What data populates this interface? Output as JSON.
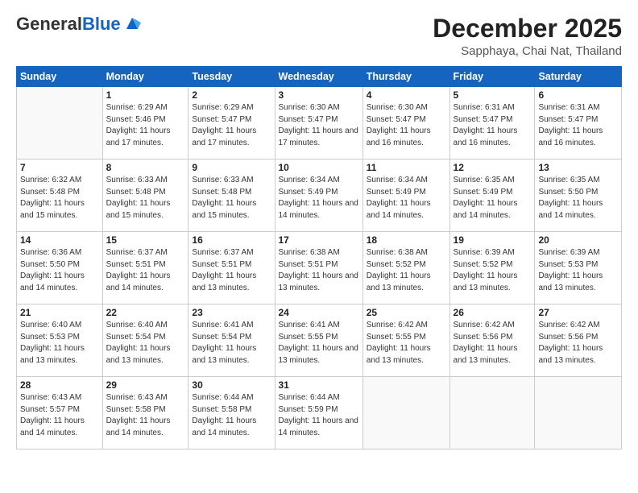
{
  "header": {
    "logo_general": "General",
    "logo_blue": "Blue",
    "month_title": "December 2025",
    "location": "Sapphaya, Chai Nat, Thailand"
  },
  "weekdays": [
    "Sunday",
    "Monday",
    "Tuesday",
    "Wednesday",
    "Thursday",
    "Friday",
    "Saturday"
  ],
  "weeks": [
    [
      {
        "day": "",
        "sunrise": "",
        "sunset": "",
        "daylight": ""
      },
      {
        "day": "1",
        "sunrise": "Sunrise: 6:29 AM",
        "sunset": "Sunset: 5:46 PM",
        "daylight": "Daylight: 11 hours and 17 minutes."
      },
      {
        "day": "2",
        "sunrise": "Sunrise: 6:29 AM",
        "sunset": "Sunset: 5:47 PM",
        "daylight": "Daylight: 11 hours and 17 minutes."
      },
      {
        "day": "3",
        "sunrise": "Sunrise: 6:30 AM",
        "sunset": "Sunset: 5:47 PM",
        "daylight": "Daylight: 11 hours and 17 minutes."
      },
      {
        "day": "4",
        "sunrise": "Sunrise: 6:30 AM",
        "sunset": "Sunset: 5:47 PM",
        "daylight": "Daylight: 11 hours and 16 minutes."
      },
      {
        "day": "5",
        "sunrise": "Sunrise: 6:31 AM",
        "sunset": "Sunset: 5:47 PM",
        "daylight": "Daylight: 11 hours and 16 minutes."
      },
      {
        "day": "6",
        "sunrise": "Sunrise: 6:31 AM",
        "sunset": "Sunset: 5:47 PM",
        "daylight": "Daylight: 11 hours and 16 minutes."
      }
    ],
    [
      {
        "day": "7",
        "sunrise": "Sunrise: 6:32 AM",
        "sunset": "Sunset: 5:48 PM",
        "daylight": "Daylight: 11 hours and 15 minutes."
      },
      {
        "day": "8",
        "sunrise": "Sunrise: 6:33 AM",
        "sunset": "Sunset: 5:48 PM",
        "daylight": "Daylight: 11 hours and 15 minutes."
      },
      {
        "day": "9",
        "sunrise": "Sunrise: 6:33 AM",
        "sunset": "Sunset: 5:48 PM",
        "daylight": "Daylight: 11 hours and 15 minutes."
      },
      {
        "day": "10",
        "sunrise": "Sunrise: 6:34 AM",
        "sunset": "Sunset: 5:49 PM",
        "daylight": "Daylight: 11 hours and 14 minutes."
      },
      {
        "day": "11",
        "sunrise": "Sunrise: 6:34 AM",
        "sunset": "Sunset: 5:49 PM",
        "daylight": "Daylight: 11 hours and 14 minutes."
      },
      {
        "day": "12",
        "sunrise": "Sunrise: 6:35 AM",
        "sunset": "Sunset: 5:49 PM",
        "daylight": "Daylight: 11 hours and 14 minutes."
      },
      {
        "day": "13",
        "sunrise": "Sunrise: 6:35 AM",
        "sunset": "Sunset: 5:50 PM",
        "daylight": "Daylight: 11 hours and 14 minutes."
      }
    ],
    [
      {
        "day": "14",
        "sunrise": "Sunrise: 6:36 AM",
        "sunset": "Sunset: 5:50 PM",
        "daylight": "Daylight: 11 hours and 14 minutes."
      },
      {
        "day": "15",
        "sunrise": "Sunrise: 6:37 AM",
        "sunset": "Sunset: 5:51 PM",
        "daylight": "Daylight: 11 hours and 14 minutes."
      },
      {
        "day": "16",
        "sunrise": "Sunrise: 6:37 AM",
        "sunset": "Sunset: 5:51 PM",
        "daylight": "Daylight: 11 hours and 13 minutes."
      },
      {
        "day": "17",
        "sunrise": "Sunrise: 6:38 AM",
        "sunset": "Sunset: 5:51 PM",
        "daylight": "Daylight: 11 hours and 13 minutes."
      },
      {
        "day": "18",
        "sunrise": "Sunrise: 6:38 AM",
        "sunset": "Sunset: 5:52 PM",
        "daylight": "Daylight: 11 hours and 13 minutes."
      },
      {
        "day": "19",
        "sunrise": "Sunrise: 6:39 AM",
        "sunset": "Sunset: 5:52 PM",
        "daylight": "Daylight: 11 hours and 13 minutes."
      },
      {
        "day": "20",
        "sunrise": "Sunrise: 6:39 AM",
        "sunset": "Sunset: 5:53 PM",
        "daylight": "Daylight: 11 hours and 13 minutes."
      }
    ],
    [
      {
        "day": "21",
        "sunrise": "Sunrise: 6:40 AM",
        "sunset": "Sunset: 5:53 PM",
        "daylight": "Daylight: 11 hours and 13 minutes."
      },
      {
        "day": "22",
        "sunrise": "Sunrise: 6:40 AM",
        "sunset": "Sunset: 5:54 PM",
        "daylight": "Daylight: 11 hours and 13 minutes."
      },
      {
        "day": "23",
        "sunrise": "Sunrise: 6:41 AM",
        "sunset": "Sunset: 5:54 PM",
        "daylight": "Daylight: 11 hours and 13 minutes."
      },
      {
        "day": "24",
        "sunrise": "Sunrise: 6:41 AM",
        "sunset": "Sunset: 5:55 PM",
        "daylight": "Daylight: 11 hours and 13 minutes."
      },
      {
        "day": "25",
        "sunrise": "Sunrise: 6:42 AM",
        "sunset": "Sunset: 5:55 PM",
        "daylight": "Daylight: 11 hours and 13 minutes."
      },
      {
        "day": "26",
        "sunrise": "Sunrise: 6:42 AM",
        "sunset": "Sunset: 5:56 PM",
        "daylight": "Daylight: 11 hours and 13 minutes."
      },
      {
        "day": "27",
        "sunrise": "Sunrise: 6:42 AM",
        "sunset": "Sunset: 5:56 PM",
        "daylight": "Daylight: 11 hours and 13 minutes."
      }
    ],
    [
      {
        "day": "28",
        "sunrise": "Sunrise: 6:43 AM",
        "sunset": "Sunset: 5:57 PM",
        "daylight": "Daylight: 11 hours and 14 minutes."
      },
      {
        "day": "29",
        "sunrise": "Sunrise: 6:43 AM",
        "sunset": "Sunset: 5:58 PM",
        "daylight": "Daylight: 11 hours and 14 minutes."
      },
      {
        "day": "30",
        "sunrise": "Sunrise: 6:44 AM",
        "sunset": "Sunset: 5:58 PM",
        "daylight": "Daylight: 11 hours and 14 minutes."
      },
      {
        "day": "31",
        "sunrise": "Sunrise: 6:44 AM",
        "sunset": "Sunset: 5:59 PM",
        "daylight": "Daylight: 11 hours and 14 minutes."
      },
      {
        "day": "",
        "sunrise": "",
        "sunset": "",
        "daylight": ""
      },
      {
        "day": "",
        "sunrise": "",
        "sunset": "",
        "daylight": ""
      },
      {
        "day": "",
        "sunrise": "",
        "sunset": "",
        "daylight": ""
      }
    ]
  ]
}
